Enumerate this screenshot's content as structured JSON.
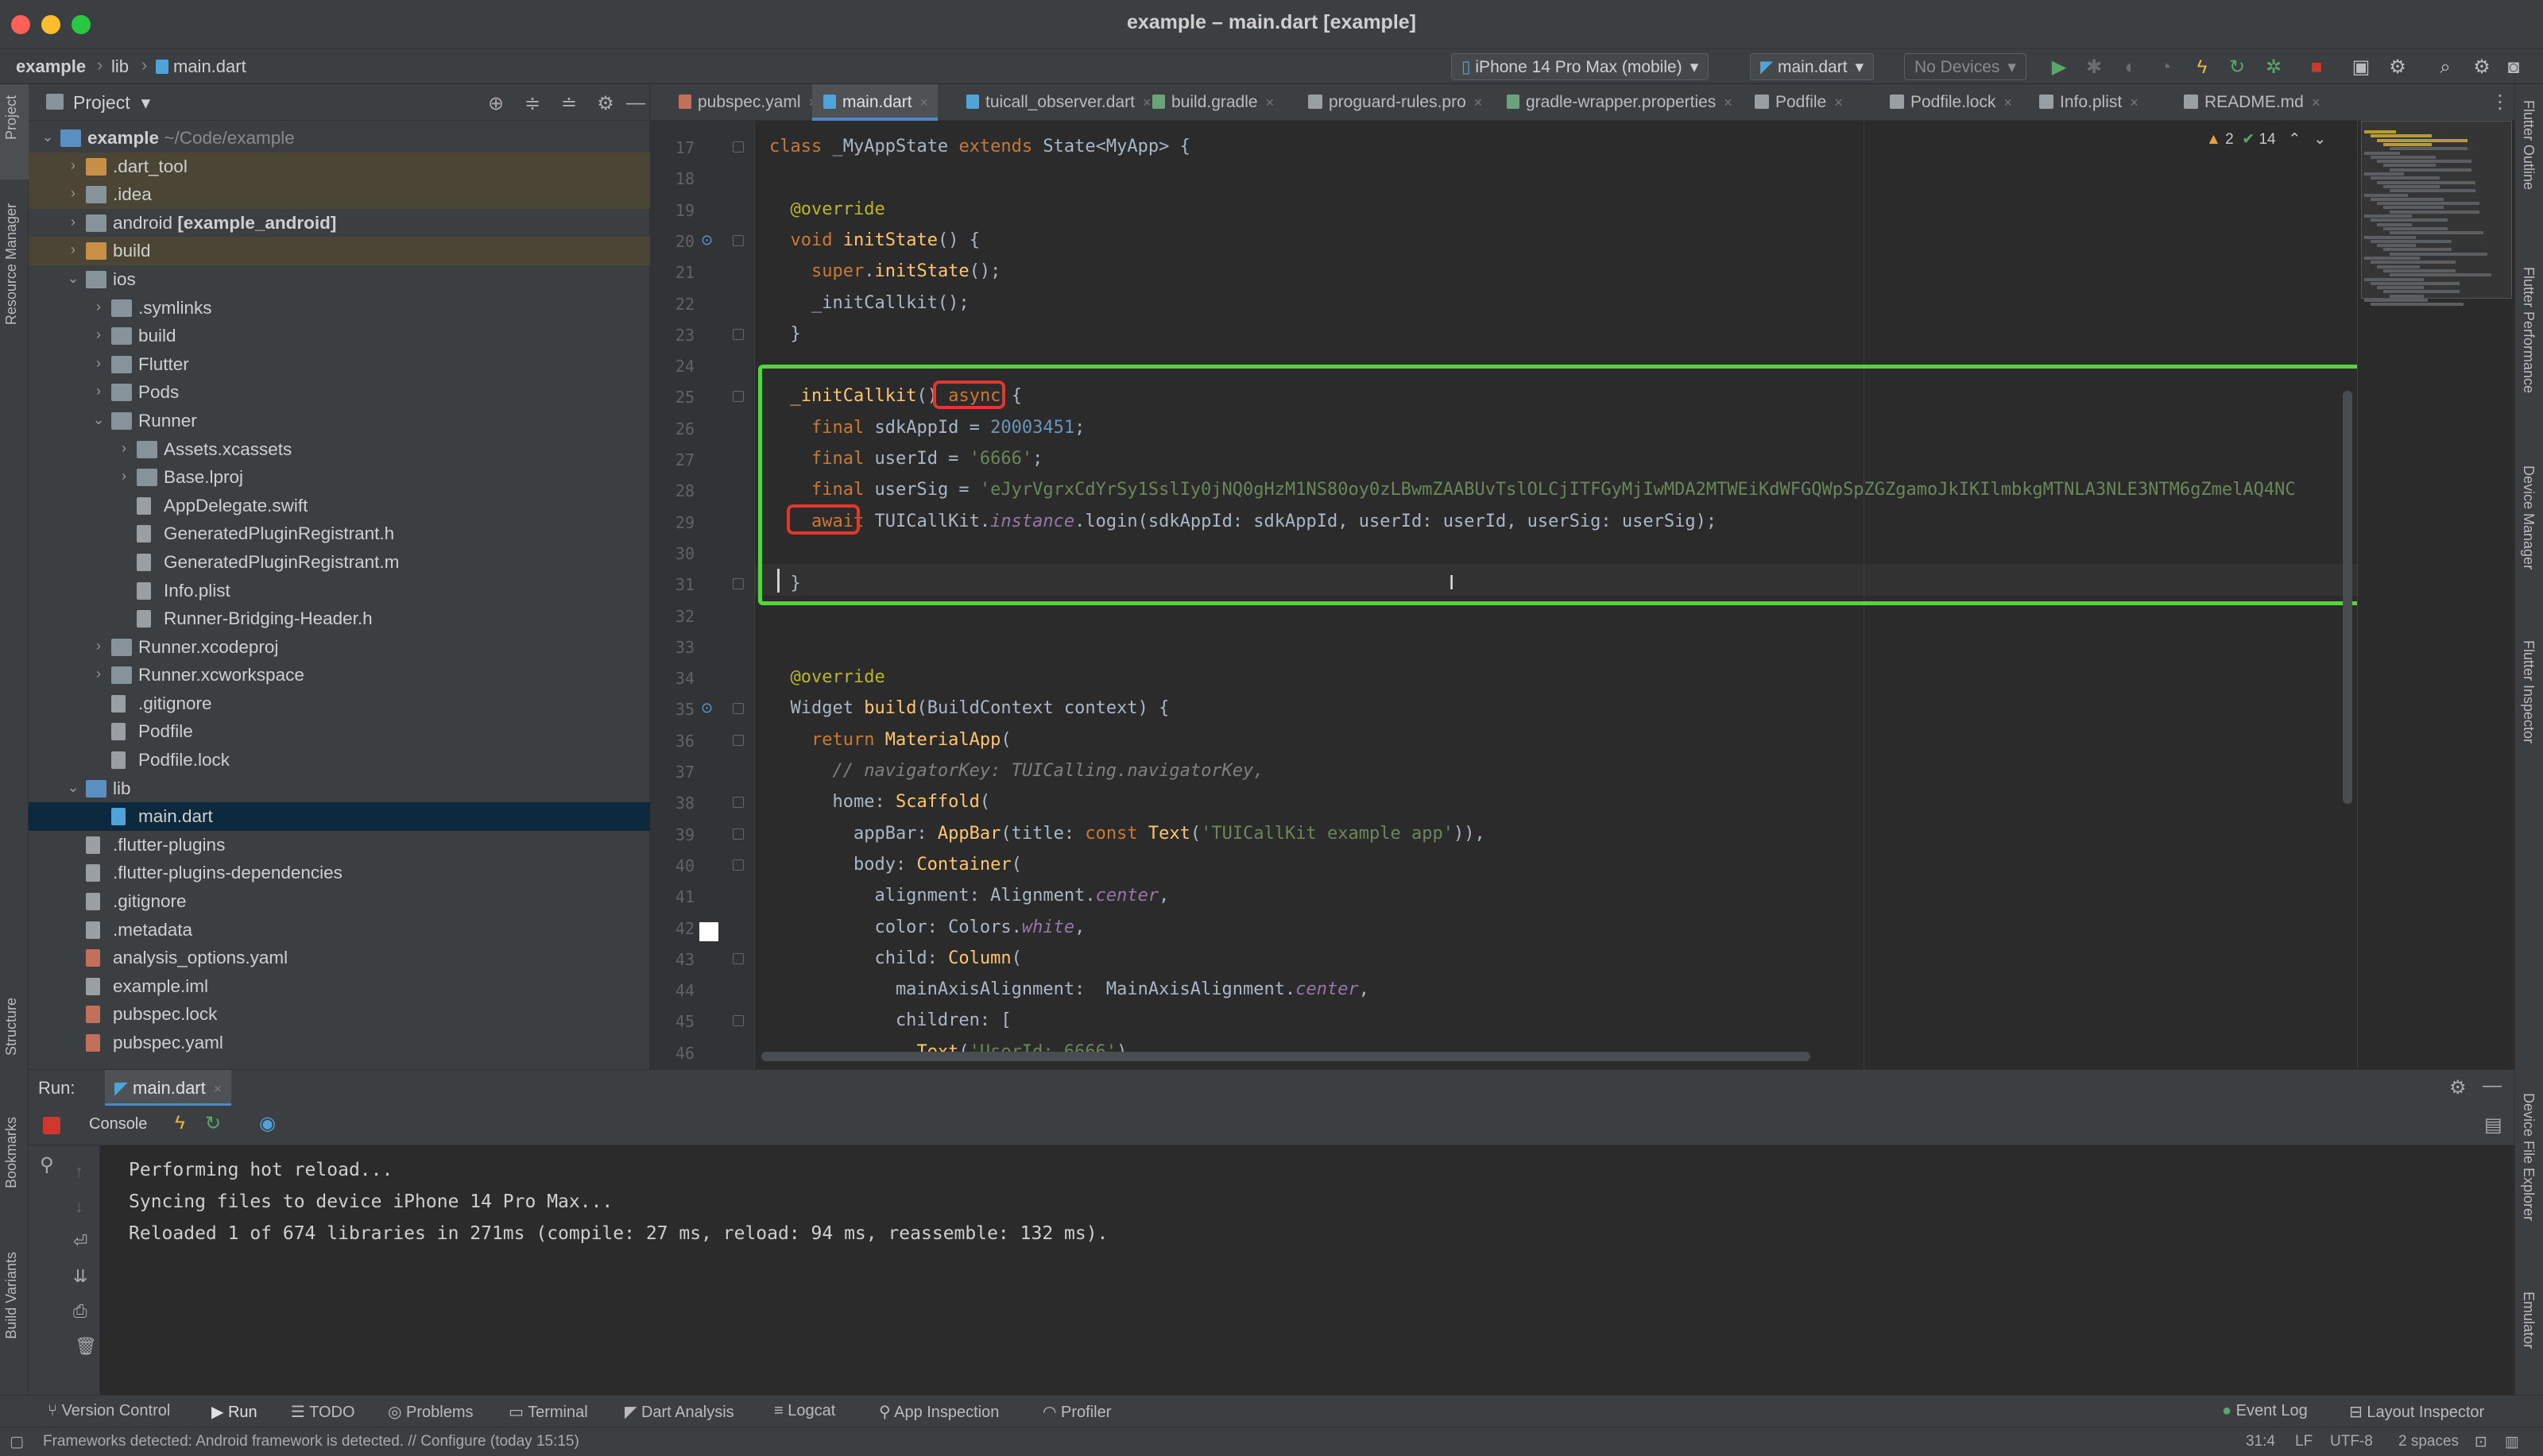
{
  "window": {
    "title": "example – main.dart [example]"
  },
  "navbar": {
    "crumbs": [
      "example",
      "lib",
      "main.dart"
    ],
    "device": "iPhone 14 Pro Max (mobile)",
    "run_config": "main.dart",
    "devices_placeholder": "No Devices"
  },
  "project_panel": {
    "title": "Project",
    "tree": [
      {
        "label": "example",
        "suffix": " ~/Code/example",
        "depth": 0,
        "arrow": "open",
        "icon": "folder-blue",
        "bold": true
      },
      {
        "label": ".dart_tool",
        "depth": 1,
        "arrow": "closed",
        "icon": "folder-orange",
        "hl": true
      },
      {
        "label": ".idea",
        "depth": 1,
        "arrow": "closed",
        "icon": "folder",
        "hl": true
      },
      {
        "label": "android",
        "suffix": " [example_android]",
        "depth": 1,
        "arrow": "closed",
        "icon": "folder",
        "suffix_bold": true
      },
      {
        "label": "build",
        "depth": 1,
        "arrow": "closed",
        "icon": "folder-orange",
        "hl": true
      },
      {
        "label": "ios",
        "depth": 1,
        "arrow": "open",
        "icon": "folder"
      },
      {
        "label": ".symlinks",
        "depth": 2,
        "arrow": "closed",
        "icon": "folder"
      },
      {
        "label": "build",
        "depth": 2,
        "arrow": "closed",
        "icon": "folder"
      },
      {
        "label": "Flutter",
        "depth": 2,
        "arrow": "closed",
        "icon": "folder"
      },
      {
        "label": "Pods",
        "depth": 2,
        "arrow": "closed",
        "icon": "folder"
      },
      {
        "label": "Runner",
        "depth": 2,
        "arrow": "open",
        "icon": "folder"
      },
      {
        "label": "Assets.xcassets",
        "depth": 3,
        "arrow": "closed",
        "icon": "folder"
      },
      {
        "label": "Base.lproj",
        "depth": 3,
        "arrow": "closed",
        "icon": "folder"
      },
      {
        "label": "AppDelegate.swift",
        "depth": 3,
        "icon": "file"
      },
      {
        "label": "GeneratedPluginRegistrant.h",
        "depth": 3,
        "icon": "file"
      },
      {
        "label": "GeneratedPluginRegistrant.m",
        "depth": 3,
        "icon": "file"
      },
      {
        "label": "Info.plist",
        "depth": 3,
        "icon": "file"
      },
      {
        "label": "Runner-Bridging-Header.h",
        "depth": 3,
        "icon": "file"
      },
      {
        "label": "Runner.xcodeproj",
        "depth": 2,
        "arrow": "closed",
        "icon": "folder"
      },
      {
        "label": "Runner.xcworkspace",
        "depth": 2,
        "arrow": "closed",
        "icon": "folder"
      },
      {
        "label": ".gitignore",
        "depth": 2,
        "icon": "file"
      },
      {
        "label": "Podfile",
        "depth": 2,
        "icon": "file"
      },
      {
        "label": "Podfile.lock",
        "depth": 2,
        "icon": "file"
      },
      {
        "label": "lib",
        "depth": 1,
        "arrow": "open",
        "icon": "folder-blue"
      },
      {
        "label": "main.dart",
        "depth": 2,
        "icon": "file-dart",
        "sel": true
      },
      {
        "label": ".flutter-plugins",
        "depth": 1,
        "icon": "file"
      },
      {
        "label": ".flutter-plugins-dependencies",
        "depth": 1,
        "icon": "file"
      },
      {
        "label": ".gitignore",
        "depth": 1,
        "icon": "file"
      },
      {
        "label": ".metadata",
        "depth": 1,
        "icon": "file"
      },
      {
        "label": "analysis_options.yaml",
        "depth": 1,
        "icon": "file-yaml"
      },
      {
        "label": "example.iml",
        "depth": 1,
        "icon": "file"
      },
      {
        "label": "pubspec.lock",
        "depth": 1,
        "icon": "file-yaml"
      },
      {
        "label": "pubspec.yaml",
        "depth": 1,
        "icon": "file-yaml"
      }
    ]
  },
  "tabs": [
    {
      "label": "pubspec.yaml",
      "icon": "yaml"
    },
    {
      "label": "main.dart",
      "icon": "dart",
      "active": true
    },
    {
      "label": "tuicall_observer.dart",
      "icon": "dart"
    },
    {
      "label": "build.gradle",
      "icon": "grad"
    },
    {
      "label": "proguard-rules.pro",
      "icon": "file"
    },
    {
      "label": "gradle-wrapper.properties",
      "icon": "grad"
    },
    {
      "label": "Podfile",
      "icon": "file"
    },
    {
      "label": "Podfile.lock",
      "icon": "file"
    },
    {
      "label": "Info.plist",
      "icon": "file"
    },
    {
      "label": "README.md",
      "icon": "file"
    }
  ],
  "editor": {
    "inspections": {
      "warnings": "2",
      "ok": "14"
    },
    "first_line": 17,
    "lines": [
      [
        [
          "kw",
          "class "
        ],
        [
          "cls",
          "_MyAppState "
        ],
        [
          "kw",
          "extends "
        ],
        [
          "cls",
          "State<MyApp> {"
        ]
      ],
      [],
      [
        [
          "t",
          "  "
        ],
        [
          "ann",
          "@override"
        ]
      ],
      [
        [
          "t",
          "  "
        ],
        [
          "kw",
          "void "
        ],
        [
          "fn",
          "initState"
        ],
        [
          "t",
          "() {"
        ]
      ],
      [
        [
          "t",
          "    "
        ],
        [
          "kw",
          "super"
        ],
        [
          "t",
          "."
        ],
        [
          "fn",
          "initState"
        ],
        [
          "t",
          "();"
        ]
      ],
      [
        [
          "t",
          "    _initCallkit();"
        ]
      ],
      [
        [
          "t",
          "  }"
        ]
      ],
      [],
      [
        [
          "t",
          "  "
        ],
        [
          "fn",
          "_initCallkit"
        ],
        [
          "t",
          "() "
        ],
        [
          "kw",
          "async "
        ],
        [
          "t",
          "{"
        ]
      ],
      [
        [
          "t",
          "    "
        ],
        [
          "kw",
          "final "
        ],
        [
          "t",
          "sdkAppId = "
        ],
        [
          "num",
          "20003451"
        ],
        [
          "t",
          ";"
        ]
      ],
      [
        [
          "t",
          "    "
        ],
        [
          "kw",
          "final "
        ],
        [
          "t",
          "userId = "
        ],
        [
          "str",
          "'6666'"
        ],
        [
          "t",
          ";"
        ]
      ],
      [
        [
          "t",
          "    "
        ],
        [
          "kw",
          "final "
        ],
        [
          "t",
          "userSig = "
        ],
        [
          "str",
          "'eJyrVgrxCdYrSy1SslIy0jNQ0gHzM1NS80oy0zLBwmZAABUvTslOLCjITFGyMjIwMDA2MTWEiKdWFGQWpSpZGZgamoJkIKIlmbkgMTNLA3NLE3NTM6gZmelAQ4NC"
        ]
      ],
      [
        [
          "t",
          "    "
        ],
        [
          "kw",
          "await "
        ],
        [
          "t",
          "TUICallKit."
        ],
        [
          "it",
          "instance"
        ],
        [
          "t",
          ".login(sdkAppId: sdkAppId, userId: userId, userSig: userSig);"
        ]
      ],
      [],
      [
        [
          "t",
          "  }"
        ]
      ],
      [],
      [],
      [
        [
          "t",
          "  "
        ],
        [
          "ann",
          "@override"
        ]
      ],
      [
        [
          "t",
          "  Widget "
        ],
        [
          "fn",
          "build"
        ],
        [
          "t",
          "(BuildContext context) {"
        ]
      ],
      [
        [
          "t",
          "    "
        ],
        [
          "kw",
          "return "
        ],
        [
          "fn",
          "MaterialApp"
        ],
        [
          "t",
          "("
        ]
      ],
      [
        [
          "t",
          "      "
        ],
        [
          "cmt",
          "// navigatorKey: TUICalling.navigatorKey,"
        ]
      ],
      [
        [
          "t",
          "      home: "
        ],
        [
          "fn",
          "Scaffold"
        ],
        [
          "t",
          "("
        ]
      ],
      [
        [
          "t",
          "        appBar: "
        ],
        [
          "fn",
          "AppBar"
        ],
        [
          "t",
          "(title: "
        ],
        [
          "kw",
          "const "
        ],
        [
          "fn",
          "Text"
        ],
        [
          "t",
          "("
        ],
        [
          "str",
          "'TUICallKit example app'"
        ],
        [
          "t",
          ")),"
        ]
      ],
      [
        [
          "t",
          "        body: "
        ],
        [
          "fn",
          "Container"
        ],
        [
          "t",
          "("
        ]
      ],
      [
        [
          "t",
          "          alignment: Alignment."
        ],
        [
          "it",
          "center"
        ],
        [
          "t",
          ","
        ]
      ],
      [
        [
          "t",
          "          color: Colors."
        ],
        [
          "it",
          "white"
        ],
        [
          "t",
          ","
        ]
      ],
      [
        [
          "t",
          "          child: "
        ],
        [
          "fn",
          "Column"
        ],
        [
          "t",
          "("
        ]
      ],
      [
        [
          "t",
          "            mainAxisAlignment:  MainAxisAlignment."
        ],
        [
          "it",
          "center"
        ],
        [
          "t",
          ","
        ]
      ],
      [
        [
          "t",
          "            children: ["
        ]
      ],
      [
        [
          "t",
          "              "
        ],
        [
          "fn",
          "Text"
        ],
        [
          "t",
          "("
        ],
        [
          "str",
          "'UserId: 6666'"
        ],
        [
          "t",
          "),"
        ]
      ]
    ]
  },
  "run_panel": {
    "title": "Run:",
    "config_tab": "main.dart",
    "console_tab": "Console",
    "output": [
      "Performing hot reload...",
      "Syncing files to device iPhone 14 Pro Max...",
      "Reloaded 1 of 674 libraries in 271ms (compile: 27 ms, reload: 94 ms, reassemble: 132 ms)."
    ]
  },
  "left_strip": [
    "Project",
    "Resource Manager",
    "Structure",
    "Bookmarks",
    "Build Variants"
  ],
  "right_strip": [
    "Flutter Outline",
    "Flutter Performance",
    "Device Manager",
    "Flutter Inspector",
    "Device File Explorer",
    "Emulator"
  ],
  "bottom_tools": [
    "Version Control",
    "Run",
    "TODO",
    "Problems",
    "Terminal",
    "Dart Analysis",
    "Logcat",
    "App Inspection",
    "Profiler"
  ],
  "bottom_right_tools": [
    "Event Log",
    "Layout Inspector"
  ],
  "status": {
    "message": "Frameworks detected: Android framework is detected. // Configure (today 15:15)",
    "position": "31:4",
    "line_sep": "LF",
    "encoding": "UTF-8",
    "indent": "2 spaces"
  },
  "colors": {
    "accent": "#4a88c7",
    "highlight_green": "#53d63a",
    "highlight_red": "#e0372f"
  }
}
